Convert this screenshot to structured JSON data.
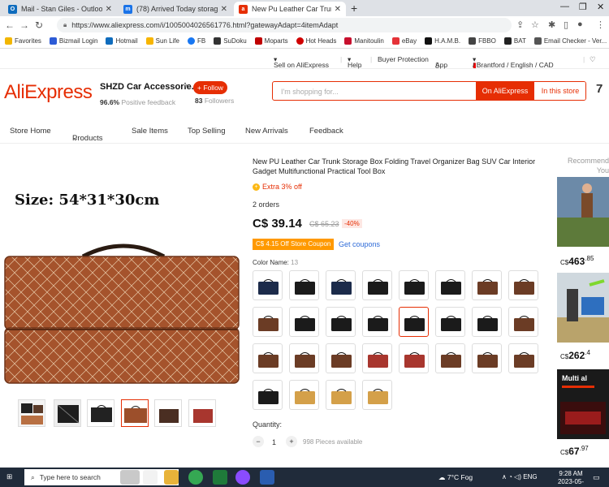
{
  "browser": {
    "tabs": [
      {
        "title": "Mail - Stan Giles - Outlook",
        "icon": "outlook-icon",
        "color": "#0f6cbd"
      },
      {
        "title": "(78) Arrived Today storage trunk",
        "icon": "m-icon",
        "color": "#1a73e8"
      },
      {
        "title": "New Pu Leather Car Trunk Storage",
        "icon": "aliexpress-icon",
        "color": "#e62e04"
      }
    ],
    "new_tab": "+",
    "url": "https://www.aliexpress.com/i/1005004026561776.html?gatewayAdapt=4itemAdapt",
    "bookmarks": [
      {
        "label": "Favorites",
        "color": "#f2b600"
      },
      {
        "label": "Bizmail Login",
        "color": "#2d5bd6"
      },
      {
        "label": "Hotmail",
        "color": "#0f6cbd"
      },
      {
        "label": "Sun Life",
        "color": "#f7b500"
      },
      {
        "label": "FB",
        "color": "#1877f2"
      },
      {
        "label": "SuDoku",
        "color": "#333333"
      },
      {
        "label": "Moparts",
        "color": "#c00000"
      },
      {
        "label": "Hot Heads",
        "color": "#d00000"
      },
      {
        "label": "Manitoulin",
        "color": "#c8102e"
      },
      {
        "label": "eBay",
        "color": "#e53238"
      },
      {
        "label": "H.A.M.B.",
        "color": "#111111"
      },
      {
        "label": "FBBO",
        "color": "#444444"
      },
      {
        "label": "BAT",
        "color": "#222222"
      },
      {
        "label": "Email Checker - Ver...",
        "color": "#555555"
      }
    ]
  },
  "ae_top": {
    "sell": "Sell on AliExpress",
    "help": "Help",
    "buyer": "Buyer Protection",
    "app": "App",
    "locale": "/ Brantford / English / CAD"
  },
  "store": {
    "logo": "AliExpress",
    "name": "SHZD Car Accessorie...",
    "follow": "+ Follow",
    "positive_pct": "96.6%",
    "positive_label": "Positive feedback",
    "followers_count": "83",
    "followers_label": "Followers",
    "search_placeholder": "I'm shopping for...",
    "on_ae": "On AliExpress",
    "in_store": "In this store",
    "truncated": "7"
  },
  "store_nav": [
    "Store Home",
    "Products",
    "Sale Items",
    "Top Selling",
    "New Arrivals",
    "Feedback"
  ],
  "gallery": {
    "size_text": "Size: 54*31*30cm"
  },
  "product": {
    "title": "New PU Leather Car Trunk Storage Box Folding Travel Organizer Bag SUV Car Interior Gadget Multifunctional Practical Tool Box",
    "extra": "Extra 3% off",
    "orders": "2 orders",
    "price": "C$ 39.14",
    "orig_price": "C$ 65.23",
    "discount": "-40%",
    "coupon": "C$ 4.15 Off Store Coupon",
    "get_coupons": "Get coupons",
    "color_label": "Color Name:",
    "color_count": "13",
    "quantity_label": "Quantity:",
    "qty": "1",
    "available": "998 Pieces available",
    "colors": [
      "navy",
      "black",
      "navy",
      "black",
      "black",
      "black",
      "brown",
      "brown",
      "brown",
      "black",
      "black",
      "black",
      "black",
      "black",
      "black",
      "brown",
      "brown",
      "brown",
      "brown",
      "red",
      "red",
      "brown",
      "brown",
      "brown",
      "black",
      "tan",
      "tan",
      "tan"
    ]
  },
  "recommended": {
    "title": "Recommend You",
    "prices": [
      {
        "main": "463",
        "frac": ".85"
      },
      {
        "main": "262",
        "frac": ".4"
      },
      {
        "main": "67",
        "frac": ".97"
      }
    ]
  },
  "taskbar": {
    "search": "Type here to search",
    "weather": "7°C  Fog",
    "lang": "ENG",
    "time": "9:28 AM",
    "date": "2023-05-05"
  }
}
